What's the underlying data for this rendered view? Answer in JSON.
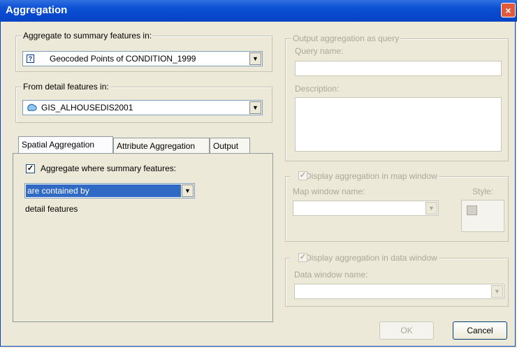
{
  "window": {
    "title": "Aggregation",
    "close": "×"
  },
  "summary_group": {
    "label": "Aggregate to summary features in:",
    "value": "Geocoded Points of CONDITION_1999"
  },
  "detail_group": {
    "label": "From detail features in:",
    "value": "GIS_ALHOUSEDIS2001"
  },
  "tabs": [
    {
      "label": "Spatial Aggregation",
      "active": true
    },
    {
      "label": "Attribute Aggregation",
      "active": false
    },
    {
      "label": "Output",
      "active": false
    }
  ],
  "spatial": {
    "checkbox_label": "Aggregate where summary features:",
    "checked": true,
    "relation_value": "are contained by",
    "trailing_text": "detail features"
  },
  "query_group": {
    "label": "Output aggregation as query",
    "query_name_label": "Query name:",
    "description_label": "Description:"
  },
  "map_group": {
    "label": "Display aggregation in map window",
    "map_window_label": "Map window name:",
    "style_label": "Style:"
  },
  "data_group": {
    "label": "Display aggregation in data window",
    "data_window_label": "Data window name:"
  },
  "buttons": {
    "ok": "OK",
    "cancel": "Cancel"
  },
  "icons": {
    "close": "close-icon",
    "layer_unknown": "question-icon",
    "layer_polygon": "polygon-layer-icon",
    "dropdown": "chevron-down-icon"
  }
}
